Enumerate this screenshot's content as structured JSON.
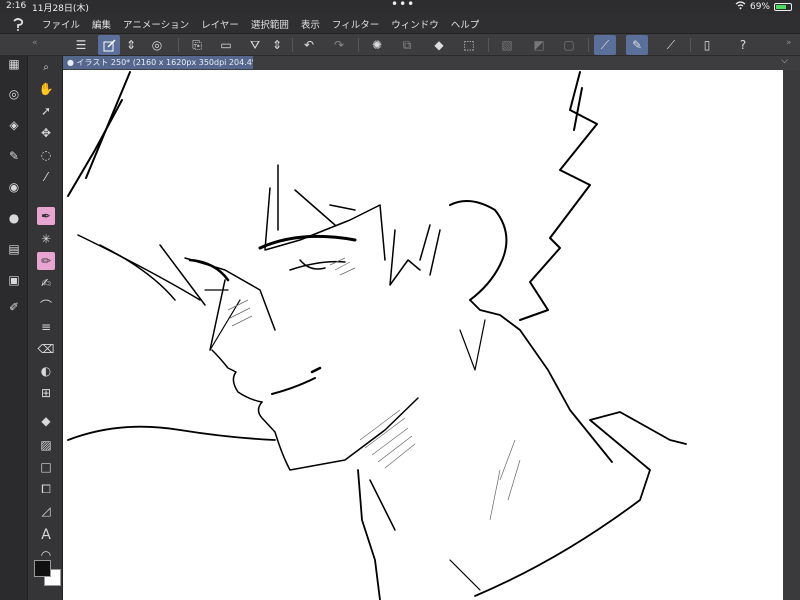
{
  "status": {
    "time": "2:16",
    "date": "11月28日(木)",
    "dots": "•••",
    "battery_percent": "69%",
    "battery_level": 0.69
  },
  "menubar": {
    "items": [
      "ファイル",
      "編集",
      "アニメーション",
      "レイヤー",
      "選択範囲",
      "表示",
      "フィルター",
      "ウィンドウ",
      "ヘルプ"
    ]
  },
  "canvas_tab": {
    "label": "イラスト 250* (2160 x 1620px 350dpi 204.4%)"
  },
  "colors": {
    "accent": "#5a6f9a",
    "tab": "#55678d",
    "active_tool": "#e9a5d2",
    "canvas": "#ffffff"
  }
}
